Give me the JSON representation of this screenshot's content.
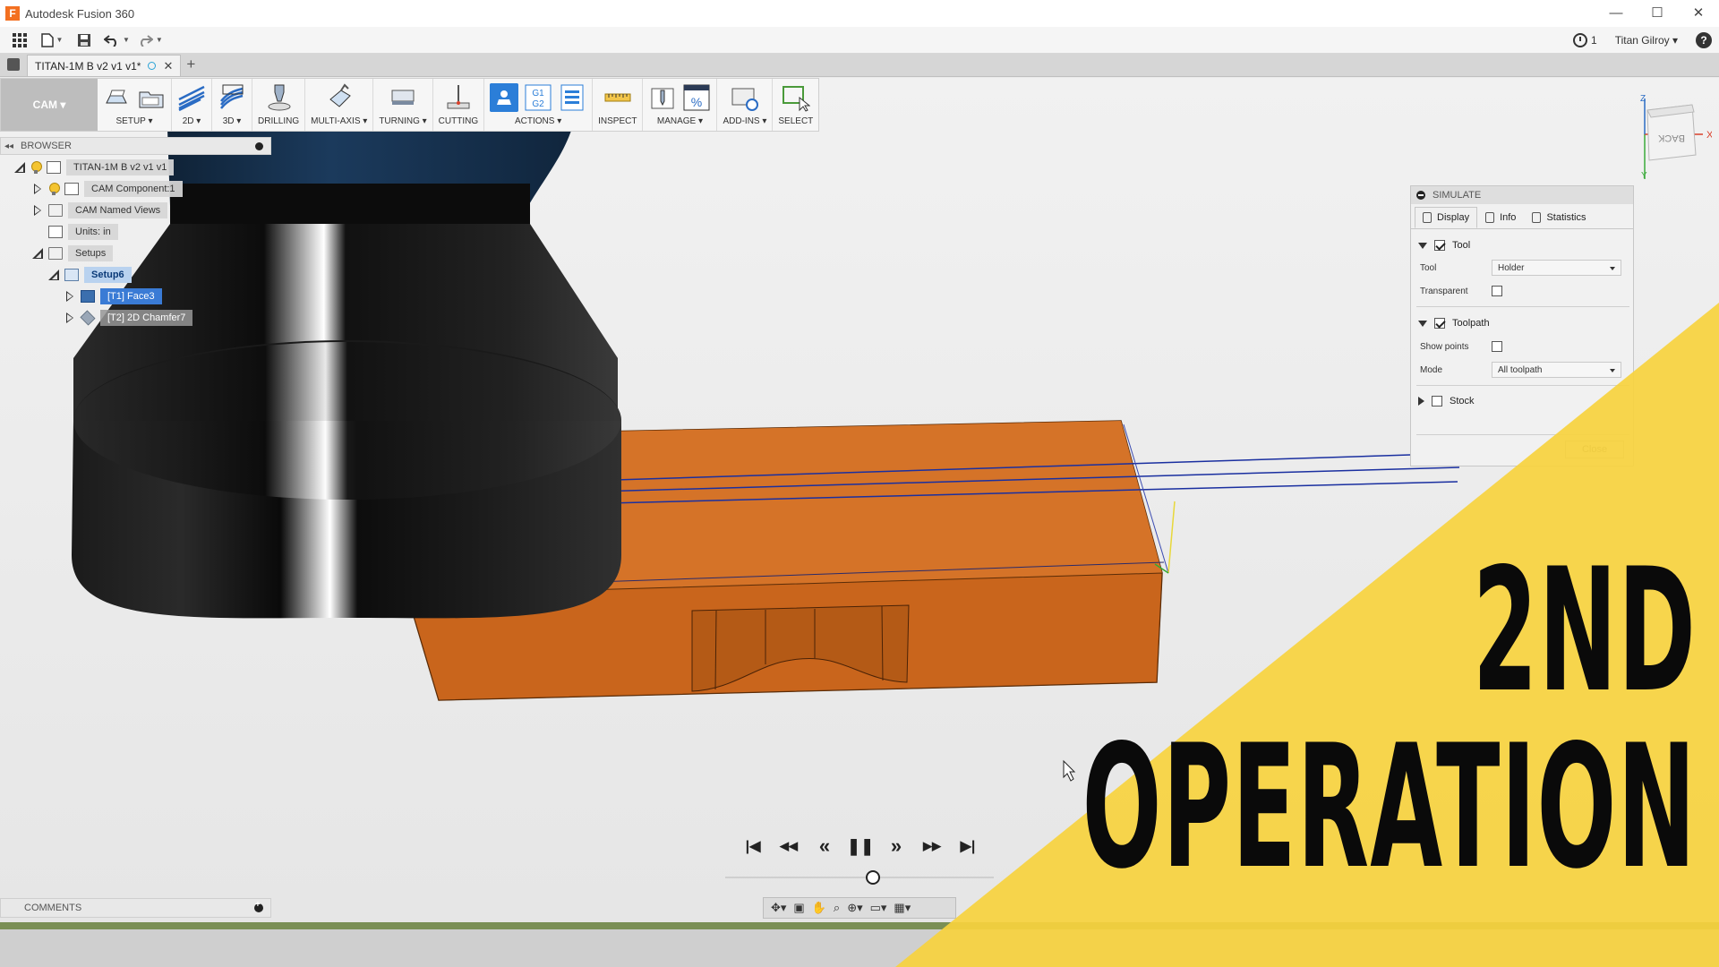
{
  "window": {
    "title": "Autodesk Fusion 360",
    "logo_letter": "F",
    "minimize": "—",
    "maximize": "☐",
    "close": "✕"
  },
  "qat": {
    "jobs_count": "1",
    "user": "Titan Gilroy ▾",
    "help": "?"
  },
  "document": {
    "tab_label": "TITAN-1M B v2 v1 v1*",
    "new_tab": "+"
  },
  "ribbon": {
    "workspace": "CAM ▾",
    "groups": [
      {
        "label": "SETUP ▾"
      },
      {
        "label": "2D ▾"
      },
      {
        "label": "3D ▾"
      },
      {
        "label": "DRILLING"
      },
      {
        "label": "MULTI-AXIS ▾"
      },
      {
        "label": "TURNING ▾"
      },
      {
        "label": "CUTTING"
      },
      {
        "label": "ACTIONS ▾"
      },
      {
        "label": "INSPECT"
      },
      {
        "label": "MANAGE ▾"
      },
      {
        "label": "ADD-INS ▾"
      },
      {
        "label": "SELECT"
      }
    ]
  },
  "browser": {
    "title": "BROWSER",
    "nodes": [
      {
        "label": "TITAN-1M B v2 v1 v1"
      },
      {
        "label": "CAM Component:1"
      },
      {
        "label": "CAM Named Views"
      },
      {
        "label": "Units: in"
      },
      {
        "label": "Setups"
      },
      {
        "label": "Setup6"
      },
      {
        "label": "[T1] Face3"
      },
      {
        "label": "[T2] 2D Chamfer7"
      }
    ]
  },
  "viewcube": {
    "face": "BACK",
    "x_axis": "X",
    "z_axis": "Z",
    "y_axis": "Y"
  },
  "simulate": {
    "title": "SIMULATE",
    "tabs": [
      {
        "label": "Display"
      },
      {
        "label": "Info"
      },
      {
        "label": "Statistics"
      }
    ],
    "tool_section": "Tool",
    "tool_label": "Tool",
    "tool_value": "Holder",
    "transparent_label": "Transparent",
    "toolpath_section": "Toolpath",
    "show_points_label": "Show points",
    "mode_label": "Mode",
    "mode_value": "All toolpath",
    "stock_section": "Stock",
    "close_label": "Close"
  },
  "playback": {
    "first": "|◀",
    "prev_op": "◀◀",
    "rewind": "«",
    "pause": "❚❚",
    "forward": "»",
    "next_op": "▶▶",
    "last": "▶|",
    "position": 0.55
  },
  "comments": {
    "title": "COMMENTS"
  },
  "overlay": {
    "line1": "2ND",
    "line2": "OPERATION",
    "color": "#f7d23e"
  },
  "colors": {
    "stock": "#cd6a1f",
    "holder": "#121212",
    "toolpath": "#1a2fa0",
    "accent": "#2b7ed8"
  }
}
